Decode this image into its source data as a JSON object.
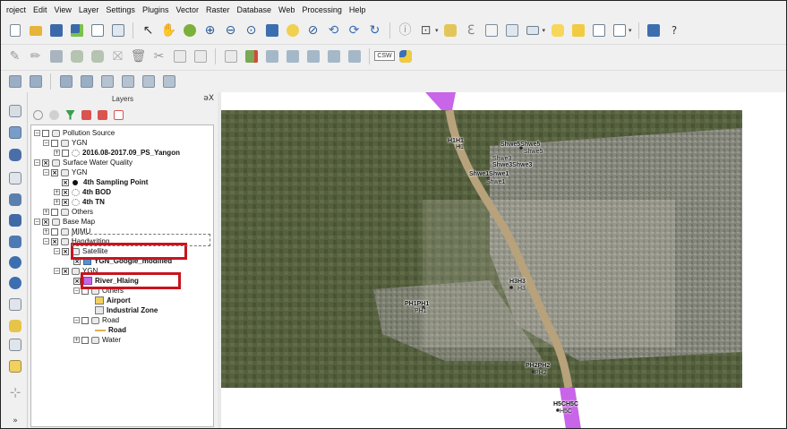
{
  "menu": [
    "roject",
    "Edit",
    "View",
    "Layer",
    "Settings",
    "Plugins",
    "Vector",
    "Raster",
    "Database",
    "Web",
    "Processing",
    "Help"
  ],
  "toolbar": {
    "csw_label": "CSW",
    "help_icon": "whats-this-icon",
    "help_glyph": "?"
  },
  "layers_panel": {
    "title": "Layers",
    "controls": "əX",
    "tree": {
      "pollution_source": "Pollution Source",
      "ygn_1": "YGN",
      "ps_layer": "2016.08-2017.09_PS_Yangon",
      "surface_water": "Surface Water Quality",
      "ygn_2": "YGN",
      "sampling_point": "4th Sampling Point",
      "bod": "4th BOD",
      "tn": "4th TN",
      "others_1": "Others",
      "base_map": "Base Map",
      "mimu": "MIMU",
      "handwriting": "Handwriting",
      "satellite": "Satellite",
      "google_modified": "YGN_Google_modified",
      "ygn_3": "YGN",
      "river_hlaing": "River_Hlaing",
      "others_2": "Others",
      "airport": "Airport",
      "industrial_zone": "Industrial Zone",
      "road_group": "Road",
      "road": "Road",
      "water": "Water"
    }
  },
  "map": {
    "labels": {
      "h1_top": "H1H1",
      "h1_bottom": "H1",
      "shwe5_top": "Shwe5Shwe5",
      "shwe5_mid": "Shwe5",
      "shwe3_top": "Shwe3",
      "shwe3_bottom": "Shwe3Shwe3",
      "shwe1_top": "Shwe1Shwe1",
      "shwe1_bottom": "Shwe1",
      "h3_top": "H3H3",
      "h3_bottom": "H3",
      "ph1_top": "PH1PH1",
      "ph1_bottom": "PH1",
      "ph2_top": "PH2PH2",
      "ph2_bottom": "PH2",
      "h5_top": "H5CH5C",
      "h5_bottom": "H5C"
    },
    "colors": {
      "river": "#c865e8",
      "satellite_green": "#4f5a3c",
      "highlight": "#c8141e"
    }
  }
}
